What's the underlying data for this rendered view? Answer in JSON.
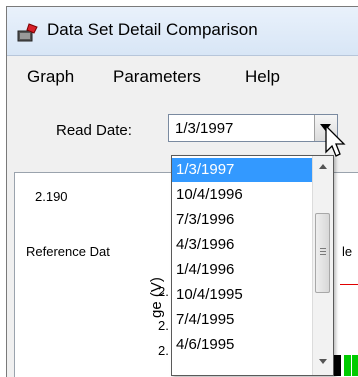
{
  "window": {
    "title": "Data Set Detail Comparison"
  },
  "menu": {
    "items": [
      "Graph",
      "Parameters",
      "Help"
    ]
  },
  "read_date": {
    "label": "Read Date:",
    "value": "1/3/1997",
    "options": [
      "1/3/1997",
      "10/4/1996",
      "7/3/1996",
      "4/3/1996",
      "1/4/1996",
      "10/4/1995",
      "7/4/1995",
      "4/6/1995"
    ],
    "selected_index": 0
  },
  "graph": {
    "value": "2.190",
    "reference_label": "Reference Dat",
    "right_label": "le",
    "y_label": "ge (V)",
    "y_ticks": [
      "2.",
      "2.",
      "2."
    ]
  },
  "colors": {
    "selection": "#3399ff",
    "bar": "#00cc00",
    "line": "#e00000"
  }
}
